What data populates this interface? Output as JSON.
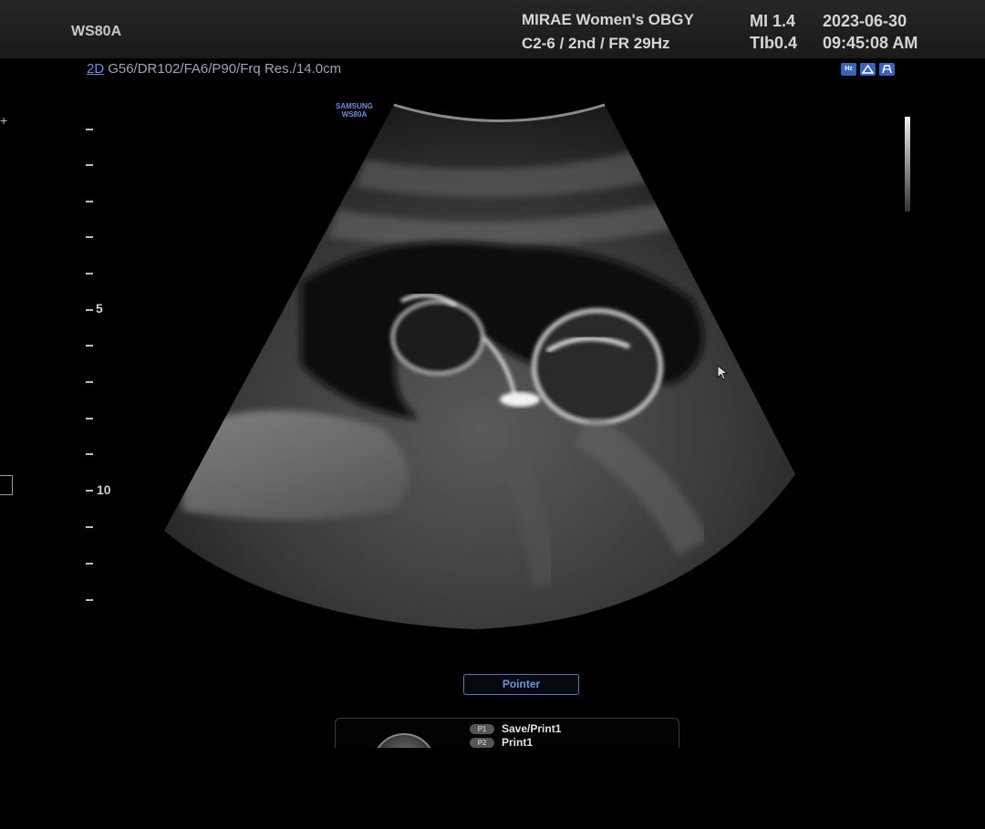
{
  "header": {
    "device_name": "WS80A",
    "hospital": "MIRAE Women's OBGY",
    "probe_info": "C2-6 / 2nd / FR 29Hz",
    "mi": "MI  1.4",
    "tib": "TIb0.4",
    "date": "2023-06-30",
    "time": "09:45:08 AM"
  },
  "imaging_params": {
    "mode": "2D",
    "settings": "G56/DR102/FA6/P90/Frq Res./14.0cm"
  },
  "brand_mark": {
    "line1": "SAMSUNG",
    "line2": "WS80A"
  },
  "depth_scale": {
    "labels": [
      "5",
      "10"
    ]
  },
  "status_icons": [
    "hdr-icon",
    "scan-icon",
    "probe-icon"
  ],
  "pointer_button": {
    "label": "Pointer"
  },
  "p_keys": [
    {
      "key": "P1",
      "label": "Save/Print1"
    },
    {
      "key": "P2",
      "label": "Print1"
    }
  ],
  "colors": {
    "accent_blue": "#6f93da",
    "background": "#000000",
    "header_bg": "#262626"
  }
}
